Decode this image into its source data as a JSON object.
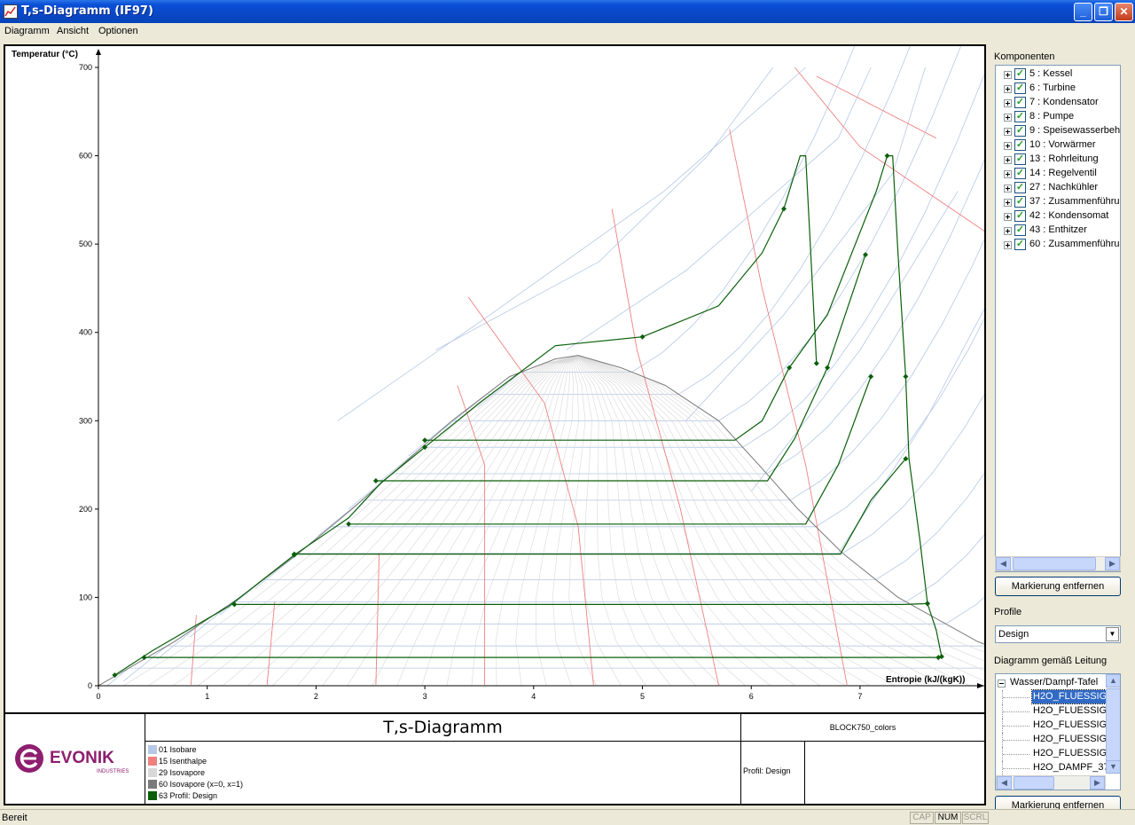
{
  "window": {
    "title": "T,s-Diagramm (IF97)",
    "minimize_glyph": "_",
    "maximize_glyph": "❐",
    "close_glyph": "✕"
  },
  "menu": [
    "Diagramm",
    "Ansicht",
    "Optionen"
  ],
  "chart": {
    "ylabel": "Temperatur (°C)",
    "xlabel": "Entropie (kJ/(kgK))",
    "yticks": [
      "700",
      "600",
      "500",
      "400",
      "300",
      "200",
      "100",
      "0"
    ],
    "xticks": [
      "0",
      "1",
      "2",
      "3",
      "4",
      "5",
      "6",
      "7"
    ]
  },
  "chart_data": {
    "type": "line",
    "xlim": [
      0,
      8
    ],
    "ylim": [
      0,
      700
    ],
    "saturation_dome": {
      "liquid": [
        [
          0,
          0
        ],
        [
          0.7,
          50
        ],
        [
          1.3,
          100
        ],
        [
          1.84,
          150
        ],
        [
          2.33,
          200
        ],
        [
          2.79,
          250
        ],
        [
          3.25,
          300
        ],
        [
          3.78,
          350
        ],
        [
          4.2,
          370
        ],
        [
          4.41,
          374
        ]
      ],
      "vapor": [
        [
          4.41,
          374
        ],
        [
          4.8,
          360
        ],
        [
          5.21,
          340
        ],
        [
          5.7,
          300
        ],
        [
          6.07,
          250
        ],
        [
          6.43,
          200
        ],
        [
          6.84,
          150
        ],
        [
          7.35,
          100
        ],
        [
          8.08,
          50
        ],
        [
          9.15,
          0
        ]
      ]
    },
    "profile_design": [
      {
        "name": "high-pressure",
        "points": [
          [
            0.15,
            12
          ],
          [
            0.5,
            40
          ],
          [
            1.2,
            90
          ],
          [
            1.8,
            148
          ],
          [
            2.3,
            190
          ],
          [
            2.6,
            230
          ],
          [
            3.0,
            270
          ],
          [
            3.5,
            320
          ],
          [
            4.2,
            385
          ],
          [
            5.0,
            395
          ],
          [
            5.7,
            430
          ],
          [
            6.1,
            490
          ],
          [
            6.3,
            540
          ],
          [
            6.45,
            600
          ],
          [
            6.5,
            600
          ],
          [
            6.6,
            365
          ]
        ]
      },
      {
        "name": "reheat",
        "points": [
          [
            3.0,
            278
          ],
          [
            5.85,
            278
          ],
          [
            6.1,
            300
          ],
          [
            6.35,
            360
          ],
          [
            6.7,
            420
          ],
          [
            7.15,
            560
          ],
          [
            7.25,
            600
          ],
          [
            7.3,
            600
          ],
          [
            7.35,
            488
          ],
          [
            7.42,
            350
          ],
          [
            7.45,
            257
          ],
          [
            7.55,
            165
          ],
          [
            7.62,
            93
          ],
          [
            7.7,
            63
          ],
          [
            7.75,
            33
          ]
        ]
      },
      {
        "name": "extraction-1",
        "points": [
          [
            2.55,
            232
          ],
          [
            6.15,
            232
          ],
          [
            6.4,
            280
          ],
          [
            6.7,
            360
          ],
          [
            7.05,
            488
          ]
        ]
      },
      {
        "name": "extraction-2",
        "points": [
          [
            2.3,
            183
          ],
          [
            6.5,
            183
          ],
          [
            6.8,
            250
          ],
          [
            7.1,
            350
          ]
        ]
      },
      {
        "name": "extraction-3",
        "points": [
          [
            1.8,
            149
          ],
          [
            6.82,
            149
          ],
          [
            7.1,
            210
          ],
          [
            7.42,
            257
          ]
        ]
      },
      {
        "name": "extraction-4",
        "points": [
          [
            1.25,
            92
          ],
          [
            7.4,
            92
          ],
          [
            7.62,
            93
          ]
        ]
      },
      {
        "name": "extraction-5",
        "points": [
          [
            0.42,
            32
          ],
          [
            7.72,
            32
          ]
        ]
      }
    ],
    "isentrops_red": [
      {
        "points": [
          [
            4.55,
            1
          ],
          [
            4.41,
            180
          ],
          [
            4.1,
            320
          ],
          [
            3.4,
            440
          ]
        ]
      },
      {
        "points": [
          [
            5.7,
            1
          ],
          [
            5.35,
            200
          ],
          [
            4.95,
            380
          ],
          [
            4.72,
            540
          ]
        ]
      },
      {
        "points": [
          [
            6.88,
            1
          ],
          [
            6.5,
            250
          ],
          [
            6.1,
            450
          ],
          [
            5.8,
            630
          ]
        ]
      },
      {
        "points": [
          [
            0.85,
            1
          ],
          [
            0.9,
            80
          ]
        ]
      },
      {
        "points": [
          [
            1.55,
            1
          ],
          [
            1.62,
            95
          ]
        ]
      },
      {
        "points": [
          [
            2.55,
            1
          ],
          [
            2.58,
            150
          ]
        ]
      },
      {
        "points": [
          [
            3.55,
            1
          ],
          [
            3.55,
            250
          ],
          [
            3.3,
            340
          ]
        ]
      },
      {
        "points": [
          [
            7.7,
            620
          ],
          [
            6.6,
            690
          ]
        ]
      },
      {
        "points": [
          [
            8.2,
            510
          ],
          [
            7.0,
            610
          ],
          [
            6.4,
            700
          ]
        ]
      }
    ],
    "legend": [
      {
        "id": "01",
        "label": "Isobare",
        "color": "#b5c8e6"
      },
      {
        "id": "15",
        "label": "Isenthalpe",
        "color": "#ee8080"
      },
      {
        "id": "29",
        "label": "Isovapore",
        "color": "#d8d8d8"
      },
      {
        "id": "60",
        "label": "Isovapore (x=0, x=1)",
        "color": "#7a7a7a"
      },
      {
        "id": "63",
        "label": "Profil: Design",
        "color": "#0a5f0a"
      }
    ]
  },
  "titleblock": {
    "title": "T,s-Diagramm",
    "block": "BLOCK750_colors",
    "profil": "Profil: Design",
    "logo_text": "EVONIK",
    "logo_sub": "INDUSTRIES",
    "legend_rows": [
      "01 Isobare",
      "15 Isenthalpe",
      "29 Isovapore",
      "60 Isovapore (x=0, x=1)",
      "63 Profil: Design"
    ]
  },
  "sidepanel": {
    "komponenten_label": "Komponenten",
    "komponenten": [
      "5 : Kessel",
      "6 : Turbine",
      "7 : Kondensator",
      "8 : Pumpe",
      "9 : Speisewasserbeh",
      "10 : Vorwärmer",
      "13 : Rohrleitung",
      "14 : Regelventil",
      "27 : Nachkühler",
      "37 : Zusammenführu",
      "42 : Kondensomat",
      "43 : Enthitzer",
      "60 : Zusammenführu"
    ],
    "marker_button": "Markierung entfernen",
    "profile_label": "Profile",
    "profile_value": "Design",
    "leitung_label": "Diagramm gemäß Leitung",
    "leitung_root": "Wasser/Dampf-Tafel",
    "leitung_items": [
      "H2O_FLUESSIG_",
      "H2O_FLUESSIG_",
      "H2O_FLUESSIG_",
      "H2O_FLUESSIG_",
      "H2O_FLUESSIG_",
      "H2O_DAMPF_37"
    ],
    "marker_button_2": "Markierung entfernen"
  },
  "status": {
    "text": "Bereit",
    "indicators": [
      "CAP",
      "NUM",
      "SCRL"
    ]
  }
}
